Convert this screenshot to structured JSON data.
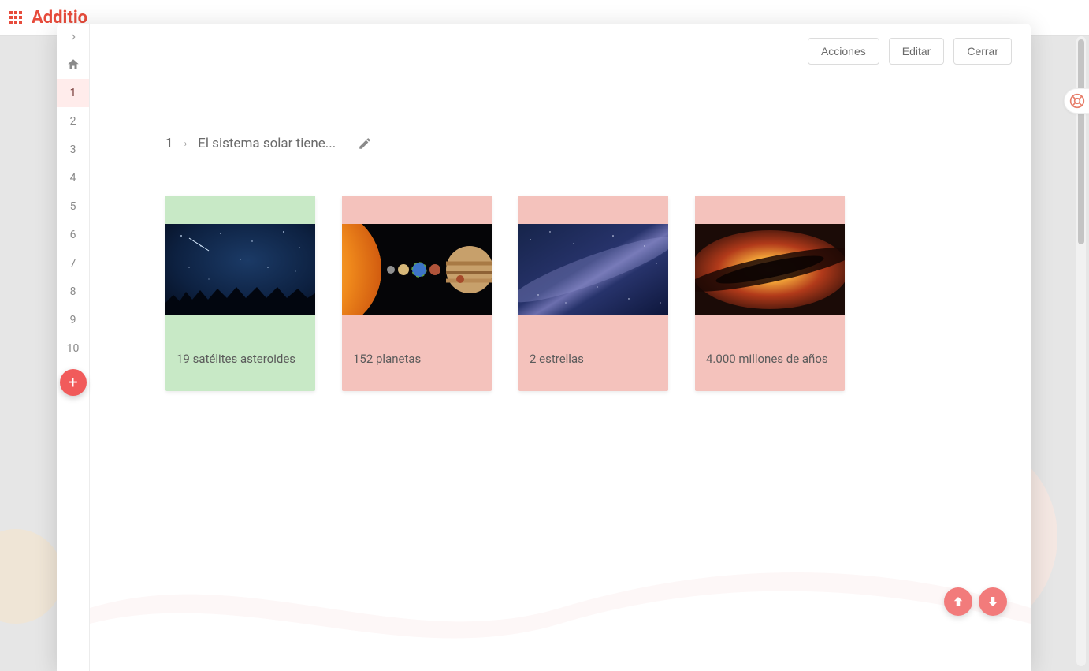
{
  "brand": "Additio",
  "actions": {
    "acciones": "Acciones",
    "editar": "Editar",
    "cerrar": "Cerrar"
  },
  "sidebar": {
    "numbers": [
      "1",
      "2",
      "3",
      "4",
      "5",
      "6",
      "7",
      "8",
      "9",
      "10"
    ],
    "active_index": 0
  },
  "question": {
    "number": "1",
    "text": "El sistema solar tiene..."
  },
  "answers": [
    {
      "label": "19 satélites asteroides",
      "correct": true
    },
    {
      "label": "152 planetas",
      "correct": false
    },
    {
      "label": "2 estrellas",
      "correct": false
    },
    {
      "label": "4.000 millones de años",
      "correct": false
    }
  ]
}
